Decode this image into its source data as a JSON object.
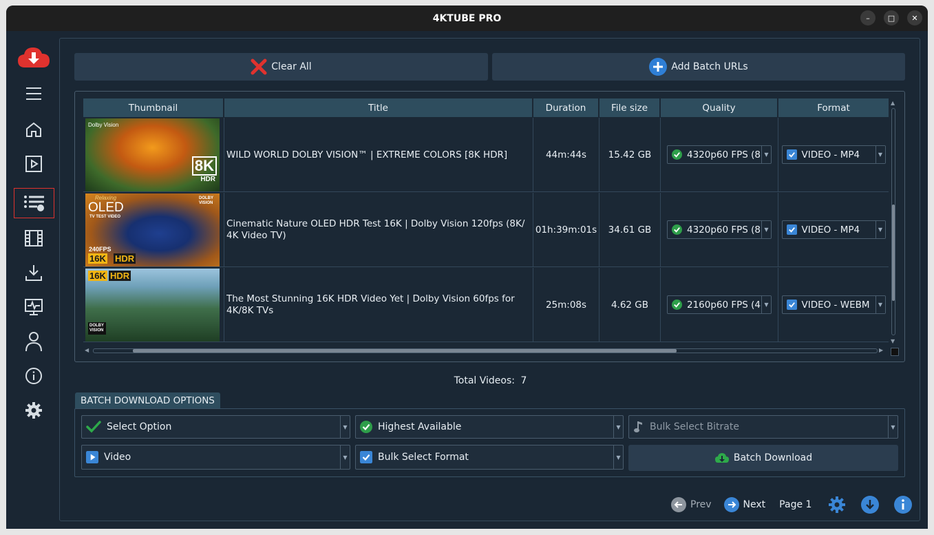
{
  "window": {
    "title": "4KTUBE PRO"
  },
  "sidebar": {
    "items": [
      {
        "name": "logo"
      },
      {
        "name": "menu"
      },
      {
        "name": "home"
      },
      {
        "name": "player"
      },
      {
        "name": "batch-list",
        "active": true
      },
      {
        "name": "video-library"
      },
      {
        "name": "downloads"
      },
      {
        "name": "monitor"
      },
      {
        "name": "account"
      },
      {
        "name": "info"
      },
      {
        "name": "settings"
      }
    ]
  },
  "toolbar": {
    "clear_all": "Clear All",
    "add_batch": "Add Batch URLs"
  },
  "table": {
    "columns": [
      "Thumbnail",
      "Title",
      "Duration",
      "File size",
      "Quality",
      "Format"
    ],
    "rows": [
      {
        "title": "WILD WORLD DOLBY VISION™ | EXTREME COLORS [8K HDR]",
        "duration": "44m:44s",
        "size": "15.42 GB",
        "quality": "4320p60 FPS (8",
        "format": "VIDEO - MP4",
        "thumb": {
          "top": "Dolby Vision",
          "badge1": "8K",
          "badge2": "HDR"
        }
      },
      {
        "title": "Cinematic Nature OLED HDR Test 16K | Dolby Vision 120fps (8K/ 4K Video TV)",
        "duration": "01h:39m:01s",
        "size": "34.61 GB",
        "quality": "4320p60 FPS (8",
        "format": "VIDEO - MP4",
        "thumb": {
          "top": "Relaxing",
          "big": "OLED",
          "sub": "TV TEST VIDEO",
          "fps": "240FPS",
          "badge1": "16K",
          "badge2": "HDR",
          "logo": "DOLBY VISION"
        }
      },
      {
        "title": "The Most Stunning 16K HDR Video Yet | Dolby Vision 60fps for 4K/8K TVs",
        "duration": "25m:08s",
        "size": "4.62 GB",
        "quality": "2160p60 FPS (4",
        "format": "VIDEO - WEBM",
        "thumb": {
          "badge1": "16K",
          "badge2": "HDR",
          "logo": "DOLBY VISION"
        }
      }
    ]
  },
  "total": {
    "label": "Total Videos:",
    "count": "7"
  },
  "batch": {
    "tab": "BATCH DOWNLOAD OPTIONS",
    "select_option": "Select Option",
    "highest": "Highest Available",
    "bitrate": "Bulk Select Bitrate",
    "video": "Video",
    "format": "Bulk Select Format",
    "download": "Batch Download"
  },
  "pager": {
    "prev": "Prev",
    "next": "Next",
    "page": "Page 1"
  },
  "colors": {
    "accent": "#3a86d6",
    "danger": "#e0322e",
    "success": "#2e9e4a",
    "header": "#2e4d5e"
  }
}
